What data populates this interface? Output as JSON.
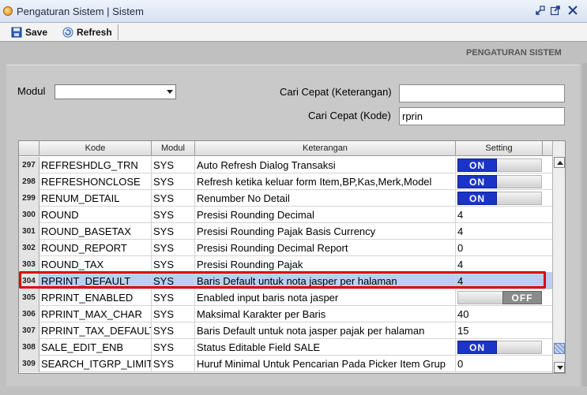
{
  "window": {
    "title": "Pengaturan Sistem | Sistem"
  },
  "toolbar": {
    "save_label": "Save",
    "refresh_label": "Refresh"
  },
  "section": {
    "title": "PENGATURAN SISTEM"
  },
  "filters": {
    "modul_label": "Modul",
    "modul_value": "",
    "cari_keterangan_label": "Cari Cepat (Keterangan)",
    "cari_keterangan_value": "",
    "cari_kode_label": "Cari Cepat (Kode)",
    "cari_kode_value": "rprin"
  },
  "grid": {
    "columns": [
      "Kode",
      "Modul",
      "Keterangan",
      "Setting"
    ],
    "rows": [
      {
        "no": "297",
        "kode": "REFRESHDLG_TRN",
        "modul": "SYS",
        "keterangan": "Auto Refresh Dialog Transaksi",
        "setting": "ON",
        "setting_type": "toggle"
      },
      {
        "no": "298",
        "kode": "REFRESHONCLOSE",
        "modul": "SYS",
        "keterangan": "Refresh ketika keluar form Item,BP,Kas,Merk,Model",
        "setting": "ON",
        "setting_type": "toggle"
      },
      {
        "no": "299",
        "kode": "RENUM_DETAIL",
        "modul": "SYS",
        "keterangan": "Renumber No Detail",
        "setting": "ON",
        "setting_type": "toggle"
      },
      {
        "no": "300",
        "kode": "ROUND",
        "modul": "SYS",
        "keterangan": "Presisi Rounding Decimal",
        "setting": "4",
        "setting_type": "text"
      },
      {
        "no": "301",
        "kode": "ROUND_BASETAX",
        "modul": "SYS",
        "keterangan": "Presisi Rounding Pajak Basis Currency",
        "setting": "4",
        "setting_type": "text"
      },
      {
        "no": "302",
        "kode": "ROUND_REPORT",
        "modul": "SYS",
        "keterangan": "Presisi Rounding Decimal Report",
        "setting": "0",
        "setting_type": "text"
      },
      {
        "no": "303",
        "kode": "ROUND_TAX",
        "modul": "SYS",
        "keterangan": "Presisi Rounding Pajak",
        "setting": "4",
        "setting_type": "text"
      },
      {
        "no": "304",
        "kode": "RPRINT_DEFAULT",
        "modul": "SYS",
        "keterangan": "Baris Default untuk nota jasper per halaman",
        "setting": "4",
        "setting_type": "text",
        "selected": true
      },
      {
        "no": "305",
        "kode": "RPRINT_ENABLED",
        "modul": "SYS",
        "keterangan": "Enabled input baris nota jasper",
        "setting": "OFF",
        "setting_type": "toggle"
      },
      {
        "no": "306",
        "kode": "RPRINT_MAX_CHAR",
        "modul": "SYS",
        "keterangan": "Maksimal Karakter per Baris",
        "setting": "40",
        "setting_type": "text"
      },
      {
        "no": "307",
        "kode": "RPRINT_TAX_DEFAULT",
        "modul": "SYS",
        "keterangan": "Baris Default untuk nota jasper pajak per halaman",
        "setting": "15",
        "setting_type": "text"
      },
      {
        "no": "308",
        "kode": "SALE_EDIT_ENB",
        "modul": "SYS",
        "keterangan": "Status Editable Field SALE",
        "setting": "ON",
        "setting_type": "toggle"
      },
      {
        "no": "309",
        "kode": "SEARCH_ITGRP_LIMIT",
        "modul": "SYS",
        "keterangan": "Huruf Minimal Untuk Pencarian Pada Picker Item Grup",
        "setting": "0",
        "setting_type": "text"
      }
    ]
  },
  "colors": {
    "toggle_on": "#1b34c8",
    "toggle_off": "#8a8a8a",
    "selection": "#b9d1ee",
    "highlight_box": "#e30000"
  }
}
